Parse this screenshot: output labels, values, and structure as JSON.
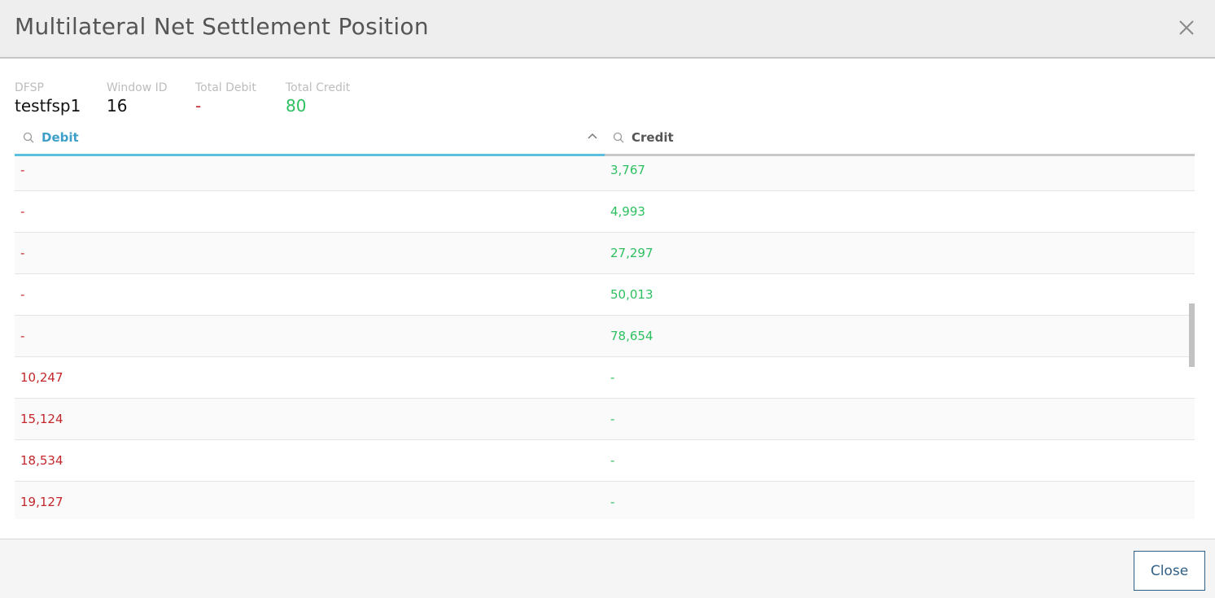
{
  "modal": {
    "title": "Multilateral Net Settlement Position",
    "close_icon": "close-icon"
  },
  "info": {
    "dfsp_label": "DFSP",
    "dfsp_value": "testfsp1",
    "window_label": "Window ID",
    "window_value": "16",
    "total_debit_label": "Total Debit",
    "total_debit_value": "-",
    "total_credit_label": "Total Credit",
    "total_credit_value": "80"
  },
  "table": {
    "columns": {
      "debit": "Debit",
      "credit": "Credit"
    },
    "sort_column": "Debit",
    "sort_direction": "ascending",
    "rows": [
      {
        "debit": "-",
        "credit": "3,767"
      },
      {
        "debit": "-",
        "credit": "4,993"
      },
      {
        "debit": "-",
        "credit": "27,297"
      },
      {
        "debit": "-",
        "credit": "50,013"
      },
      {
        "debit": "-",
        "credit": "78,654"
      },
      {
        "debit": "10,247",
        "credit": "-"
      },
      {
        "debit": "15,124",
        "credit": "-"
      },
      {
        "debit": "18,534",
        "credit": "-"
      },
      {
        "debit": "19,127",
        "credit": "-"
      }
    ]
  },
  "footer": {
    "close_label": "Close"
  },
  "colors": {
    "debit": "#c3272b",
    "credit": "#2ec060",
    "accent": "#5bc0de",
    "button": "#2f5f85"
  }
}
